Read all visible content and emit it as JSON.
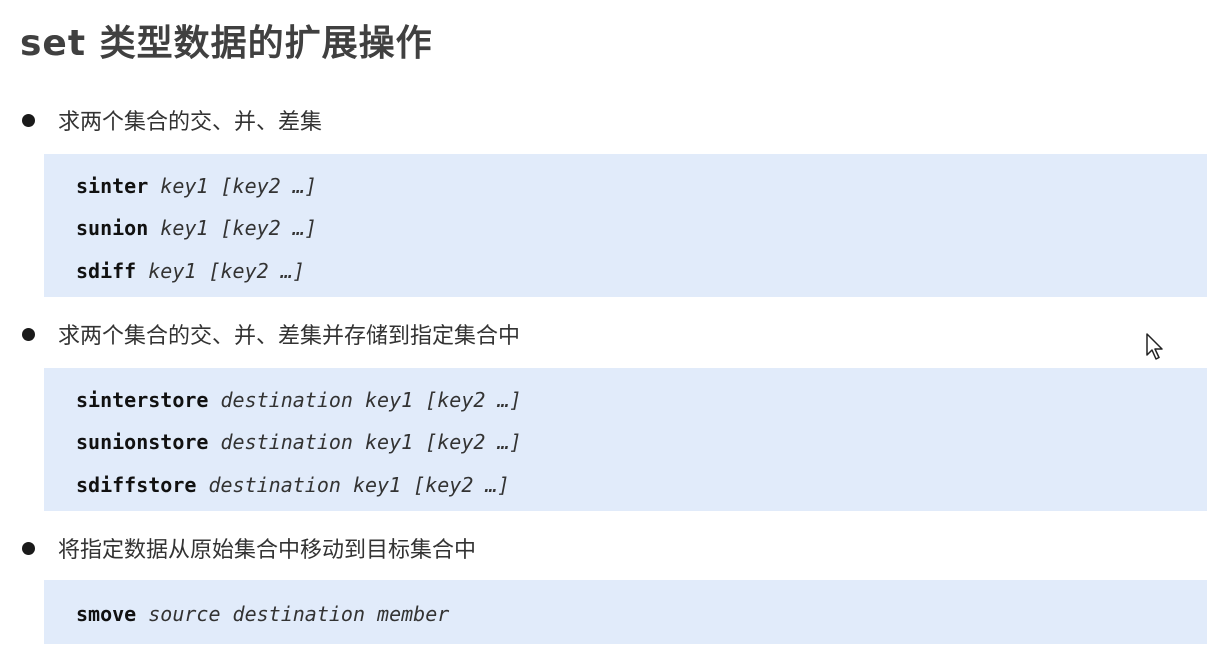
{
  "title": "set 类型数据的扩展操作",
  "sections": [
    {
      "bullet": "求两个集合的交、并、差集",
      "lines": [
        {
          "cmd": "sinter",
          "args": "key1 [key2 …]"
        },
        {
          "cmd": "sunion",
          "args": "key1 [key2 …]"
        },
        {
          "cmd": "sdiff",
          "args": "key1 [key2 …]"
        }
      ]
    },
    {
      "bullet": "求两个集合的交、并、差集并存储到指定集合中",
      "lines": [
        {
          "cmd": "sinterstore",
          "args": "destination key1 [key2 …]"
        },
        {
          "cmd": "sunionstore",
          "args": "destination key1 [key2 …]"
        },
        {
          "cmd": "sdiffstore",
          "args": "destination key1 [key2 …]"
        }
      ]
    },
    {
      "bullet": "将指定数据从原始集合中移动到目标集合中",
      "lines": [
        {
          "cmd": "smove",
          "args": "source destination member"
        }
      ]
    }
  ],
  "colors": {
    "code_background": "#e1ebfa",
    "title_text": "#404040"
  },
  "icons": {
    "bullet": "filled-circle",
    "pointer": "mouse-cursor-icon"
  }
}
